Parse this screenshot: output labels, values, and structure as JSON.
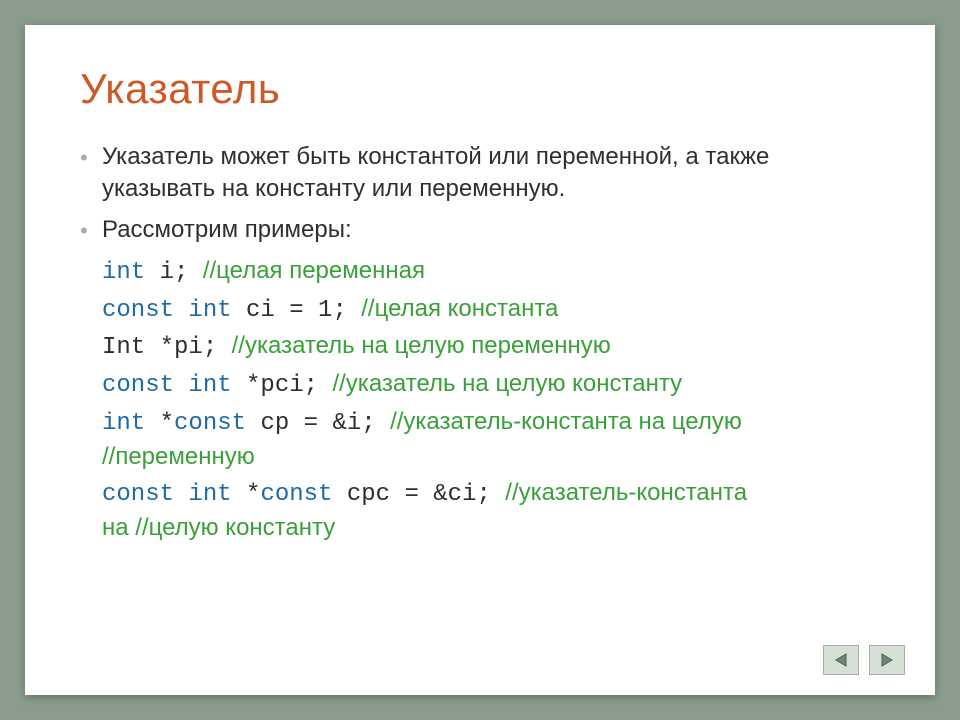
{
  "title": "Указатель",
  "bullets": {
    "b1": "Указатель может быть константой или переменной, а также указывать на константу или переменную.",
    "b2": "Рассмотрим примеры:"
  },
  "ex": {
    "l1": {
      "kw": "int ",
      "code": "i; ",
      "cm": "//целая переменная"
    },
    "l2": {
      "kw": "const int ",
      "code": "ci = 1; ",
      "cm": "//целая константа"
    },
    "l3": {
      "code1": "Int *pi; ",
      "cm": "//указатель на целую переменную"
    },
    "l4": {
      "kw": "const int ",
      "code": "*pci; ",
      "cm": "//указатель на целую константу"
    },
    "l5": {
      "kw1": "int ",
      "code1": "*",
      "kw2": "const ",
      "code2": "cp = &i; ",
      "cm1": "//указатель-константа на целую",
      "cm2": "//переменную"
    },
    "l6": {
      "kw1": "const int ",
      "code1": "*",
      "kw2": "const ",
      "code2": "cpc = &ci; ",
      "cm1": "//указатель-константа",
      "cm2": "на //целую константу"
    }
  },
  "nav": {
    "prev": "prev",
    "next": "next"
  }
}
